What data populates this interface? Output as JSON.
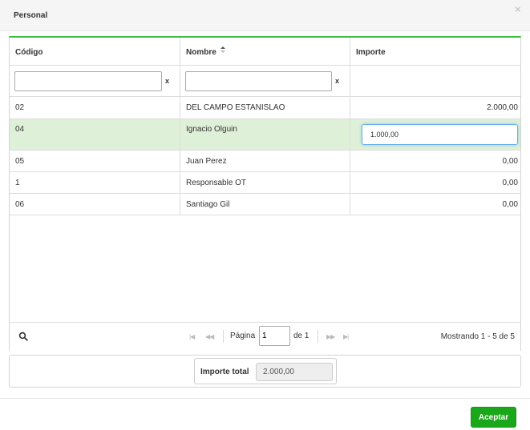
{
  "dialog": {
    "title": "Personal",
    "close_symbol": "×"
  },
  "grid": {
    "columns": [
      {
        "label": "Código"
      },
      {
        "label": "Nombre",
        "sort": "ascending"
      },
      {
        "label": "Importe"
      }
    ],
    "filters": {
      "codigo_value": "",
      "nombre_value": "",
      "clear_symbol": "x"
    },
    "rows": [
      {
        "codigo": "02",
        "nombre": "DEL CAMPO ESTANISLAO",
        "importe": "2.000,00"
      },
      {
        "codigo": "04",
        "nombre": "Ignacio Olguin",
        "importe": "1.000,00",
        "selected": true,
        "editing": true
      },
      {
        "codigo": "05",
        "nombre": "Juan Perez",
        "importe": "0,00"
      },
      {
        "codigo": "1",
        "nombre": "Responsable OT",
        "importe": "0,00"
      },
      {
        "codigo": "06",
        "nombre": "Santiago Gil",
        "importe": "0,00"
      }
    ],
    "pager": {
      "page_label": "Página",
      "current_page": "1",
      "of_label": "de 1",
      "info": "Mostrando 1 - 5 de 5"
    }
  },
  "total": {
    "label": "Importe total",
    "value": "2.000,00"
  },
  "footer": {
    "accept_label": "Aceptar"
  },
  "colors": {
    "accent_green": "#3dbd3d",
    "selected_row": "#dff0d8",
    "button_green": "#1aa81a",
    "focus_blue": "#66afe9"
  }
}
